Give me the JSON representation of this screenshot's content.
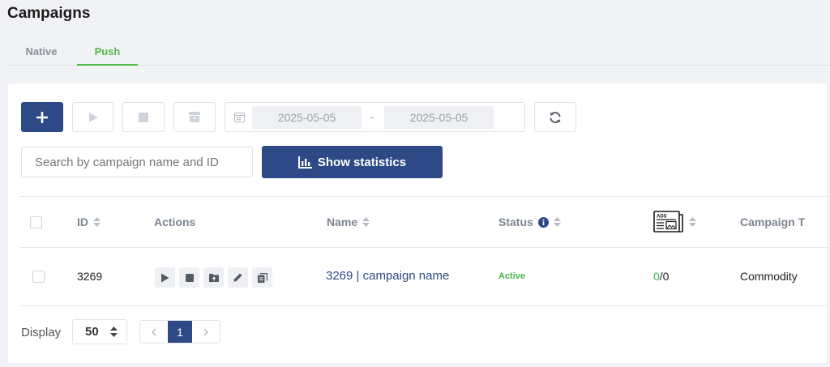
{
  "page": {
    "title": "Campaigns"
  },
  "tabs": [
    {
      "label": "Native",
      "active": false
    },
    {
      "label": "Push",
      "active": true
    }
  ],
  "toolbar": {
    "add_label": "+",
    "date_start": "2025-05-05",
    "date_separator": "-",
    "date_end": "2025-05-05",
    "icons": [
      "plus-icon",
      "play-icon",
      "stop-icon",
      "archive-icon",
      "calendar-icon",
      "refresh-icon"
    ]
  },
  "search": {
    "placeholder": "Search by campaign name and ID",
    "value": ""
  },
  "stats_button": {
    "label": "Show statistics",
    "icon": "bar-chart-icon"
  },
  "table": {
    "columns": [
      {
        "label": "ID",
        "sortable": true
      },
      {
        "label": "Actions",
        "sortable": false
      },
      {
        "label": "Name",
        "sortable": true
      },
      {
        "label": "Status",
        "sortable": true,
        "info": true
      },
      {
        "label": "",
        "icon": "ads-newspaper-icon",
        "sortable": true
      },
      {
        "label": "Campaign T",
        "sortable": false
      }
    ],
    "rows": [
      {
        "id": "3269",
        "actions": [
          "play-icon",
          "stop-icon",
          "folder-icon",
          "pencil-icon",
          "copy-icon"
        ],
        "name": "3269 | campaign name",
        "status": "Active",
        "ads_active": "0",
        "ads_total": "/0",
        "campaign_type": "Commodity"
      }
    ]
  },
  "footer": {
    "display_label": "Display",
    "page_size": "50",
    "pages": [
      "1"
    ],
    "current_page": "1"
  },
  "colors": {
    "primary": "#2d4a86",
    "accent_green": "#55b84a",
    "status_active": "#46b44a",
    "background": "#f1f2f5"
  }
}
